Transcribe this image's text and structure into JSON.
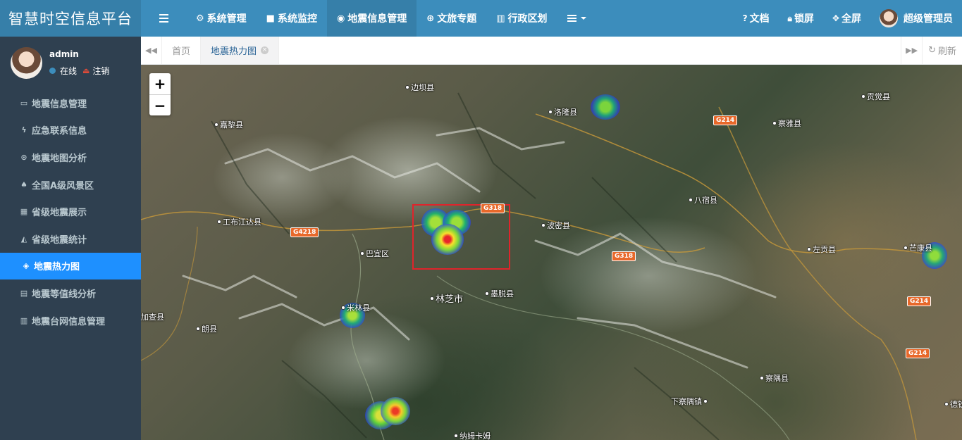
{
  "app": {
    "title": "智慧时空信息平台"
  },
  "topnav": [
    {
      "icon": "gear-icon",
      "label": "系统管理"
    },
    {
      "icon": "video-icon",
      "label": "系统监控"
    },
    {
      "icon": "map-marker-icon",
      "label": "地震信息管理",
      "active": true
    },
    {
      "icon": "globe-icon",
      "label": "文旅专题"
    },
    {
      "icon": "bank-icon",
      "label": "行政区划"
    }
  ],
  "rightnav": {
    "docs": "文档",
    "lock": "锁屏",
    "fullscreen": "全屏",
    "user": "超级管理员"
  },
  "user": {
    "name": "admin",
    "status": "在线",
    "logout": "注销"
  },
  "sidebar": {
    "items": [
      {
        "icon": "hdd-icon",
        "label": "地震信息管理"
      },
      {
        "icon": "bolt-icon",
        "label": "应急联系信息"
      },
      {
        "icon": "dot-circle-icon",
        "label": "地震地图分析"
      },
      {
        "icon": "tree-icon",
        "label": "全国A级风景区"
      },
      {
        "icon": "cubes-icon",
        "label": "省级地震展示"
      },
      {
        "icon": "area-chart-icon",
        "label": "省级地震统计"
      },
      {
        "icon": "cube-icon",
        "label": "地震热力图",
        "active": true
      },
      {
        "icon": "barcode-icon",
        "label": "地震等值线分析"
      },
      {
        "icon": "bank-icon",
        "label": "地震台网信息管理"
      }
    ]
  },
  "tabs": {
    "home": "首页",
    "active": "地震热力图",
    "refresh": "刷新"
  },
  "map": {
    "zoom_in": "+",
    "zoom_out": "−",
    "places": [
      "边坝县",
      "洛隆县",
      "贡觉县",
      "嘉黎县",
      "察雅县",
      "八宿县",
      "工布江达县",
      "波密县",
      "巴宜区",
      "左贡县",
      "芒康县",
      "米林县",
      "林芝市",
      "墨脱县",
      "加查县",
      "朗县",
      "察隅县",
      "下察隅镇",
      "德钦",
      "纳姆卡姆"
    ],
    "roads": [
      "G214",
      "G318",
      "G4218",
      "G318",
      "G214",
      "G214"
    ]
  }
}
